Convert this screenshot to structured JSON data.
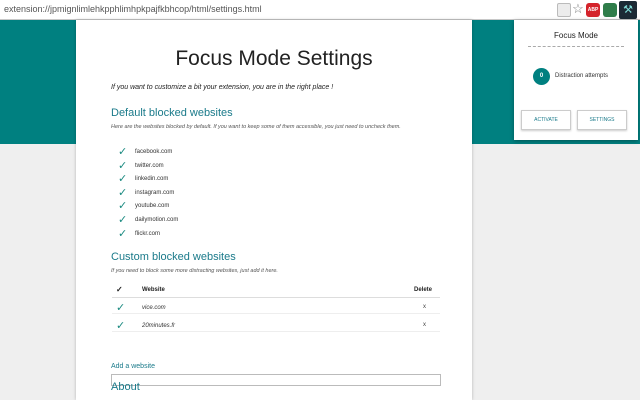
{
  "browser": {
    "url": "extension://jpmignlimlehkpphlimhpkpajfkbhcop/html/settings.html",
    "icons": [
      "translate-icon",
      "star-icon",
      "adblock-icon",
      "shield-icon",
      "focus-mode-icon"
    ],
    "abp_label": "ABP"
  },
  "colors": {
    "accent": "#008080",
    "link": "#1a7a8a"
  },
  "page": {
    "title": "Focus Mode Settings",
    "intro": "If you want to customize a bit your extension, you are in the right place !",
    "default_section": {
      "title": "Default blocked websites",
      "description": "Here are the websites blocked by default. If you want to keep some of them accessible, you just need to uncheck them.",
      "sites": [
        "facebook.com",
        "twitter.com",
        "linkedin.com",
        "instagram.com",
        "youtube.com",
        "dailymotion.com",
        "flickr.com"
      ]
    },
    "custom_section": {
      "title": "Custom blocked websites",
      "description": "If you need to block some more distracting websites, just add it here.",
      "header_check": "✓",
      "header_website": "Website",
      "header_delete": "Delete",
      "rows": [
        {
          "site": "vice.com",
          "delete": "x"
        },
        {
          "site": "20minutes.fr",
          "delete": "x"
        }
      ],
      "add_label": "Add a website",
      "add_placeholder": ""
    },
    "about_title": "About"
  },
  "popup": {
    "title": "Focus Mode",
    "count": "0",
    "count_label": "Distraction attempts",
    "activate_label": "ACTIVATE",
    "settings_label": "SETTINGS"
  }
}
